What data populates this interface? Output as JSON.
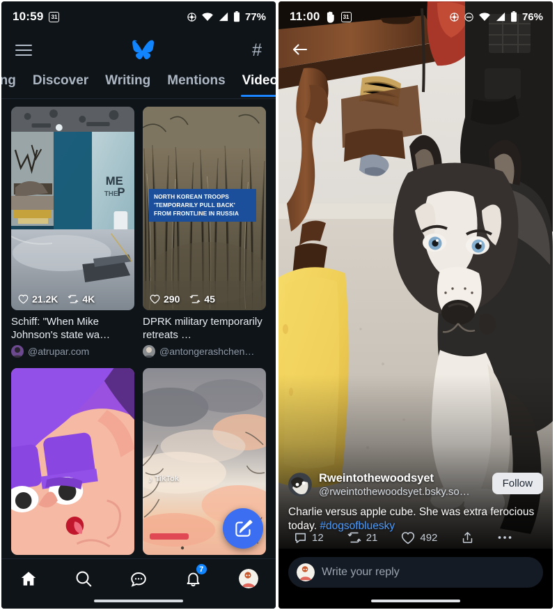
{
  "app": {
    "name": "Bluesky",
    "accent": "#1185fe",
    "bg": "#0f1419"
  },
  "left": {
    "statusbar": {
      "time": "10:59",
      "calendar_day": "31",
      "icons": [
        "calendar-icon",
        "location-icon",
        "wifi-icon",
        "cellular-icon",
        "battery-icon"
      ],
      "battery": "77%"
    },
    "header": {
      "menu_label": "menu-icon",
      "logo_label": "bluesky-butterfly-logo",
      "feeds_label": "#"
    },
    "tabs": [
      {
        "label": "owing",
        "active": false
      },
      {
        "label": "Discover",
        "active": false
      },
      {
        "label": "Writing",
        "active": false
      },
      {
        "label": "Mentions",
        "active": false
      },
      {
        "label": "Video",
        "active": true
      }
    ],
    "videos": [
      {
        "title": "Schiff: \"When Mike Johnson's state wa…",
        "handle": "@atrupar.com",
        "likes": "21.2K",
        "reposts": "4K",
        "thumb": "news-studio-meet-the-press",
        "overlay_text": "ME THE P"
      },
      {
        "title": "DPRK military temporarily retreats …",
        "handle": "@antongerashchen…",
        "likes": "290",
        "reposts": "45",
        "thumb": "winter-field-news-chyron",
        "chyron": [
          "NORTH KOREAN TROOPS",
          "'TEMPORARILY PULL BACK'",
          "FROM FRONTLINE IN RUSSIA"
        ]
      },
      {
        "title": "",
        "handle": "",
        "likes": "",
        "reposts": "",
        "thumb": "cartoon-purple-hair-character"
      },
      {
        "title": "",
        "handle": "",
        "likes": "",
        "reposts": "",
        "thumb": "sunset-clouds-tiktok",
        "watermark": "TikTok"
      }
    ],
    "fab": {
      "label": "compose-post"
    },
    "bottomnav": [
      {
        "name": "home",
        "active": true,
        "badge": ""
      },
      {
        "name": "search",
        "active": false,
        "badge": ""
      },
      {
        "name": "messages",
        "active": false,
        "badge": ""
      },
      {
        "name": "notifications",
        "active": false,
        "badge": "7"
      },
      {
        "name": "profile",
        "active": false,
        "badge": ""
      }
    ]
  },
  "right": {
    "statusbar": {
      "time": "11:00",
      "calendar_day": "31",
      "icons": [
        "hand-icon",
        "calendar-icon",
        "location-icon",
        "dnd-icon",
        "wifi-icon",
        "cellular-icon",
        "battery-icon"
      ],
      "battery": "76%"
    },
    "back_label": "back-arrow",
    "post": {
      "display_name": "Rweintothewoodsyet",
      "handle": "@rweintothewoodsyet.bsky.so…",
      "follow_label": "Follow",
      "caption_text": "Charlie versus apple cube. She was extra ferocious today. ",
      "caption_hashtag": "#dogsofbluesky",
      "replies": "12",
      "reposts": "21",
      "likes": "492",
      "share_label": "share-icon",
      "more_label": "more-options"
    },
    "composer": {
      "placeholder": "Write your reply"
    },
    "video_subject": "siberian-husky-dog-indoors"
  }
}
